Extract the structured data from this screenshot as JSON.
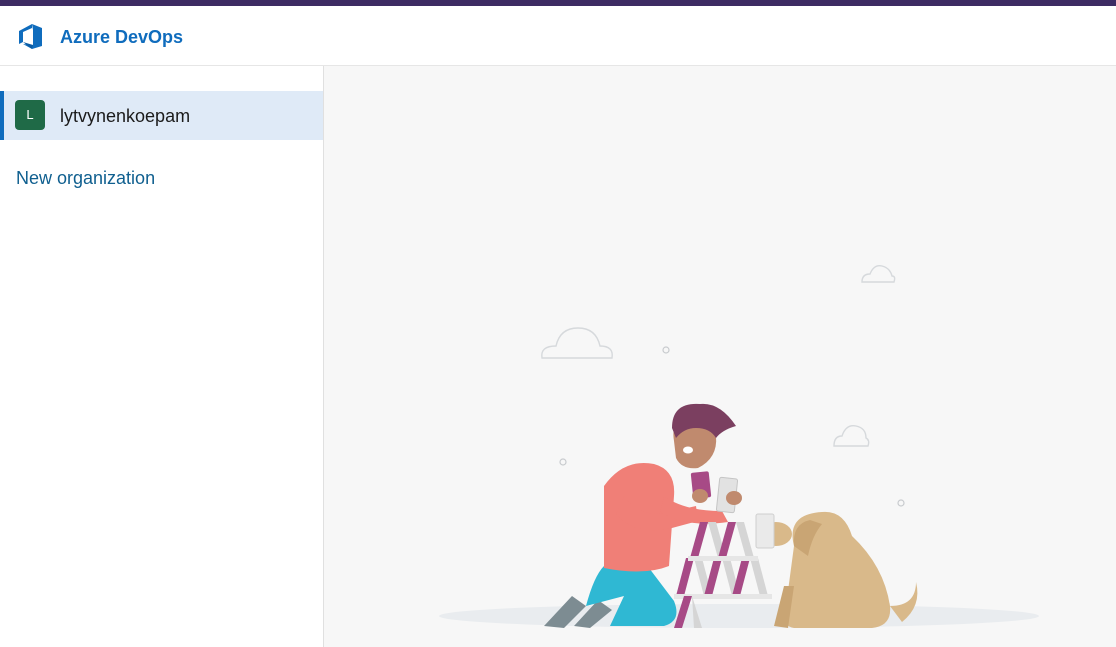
{
  "header": {
    "brand": "Azure DevOps",
    "logo_icon": "azure-devops-logo-icon",
    "accent_color": "#3d2b63",
    "brand_color": "#0f6cbd"
  },
  "sidebar": {
    "organizations": [
      {
        "avatar_letter": "L",
        "name": "lytvynenkoepam",
        "selected": true,
        "avatar_color": "#1f6a47"
      }
    ],
    "new_organization_label": "New organization"
  },
  "main": {
    "illustration": "person-building-house-of-cards-with-dog"
  }
}
